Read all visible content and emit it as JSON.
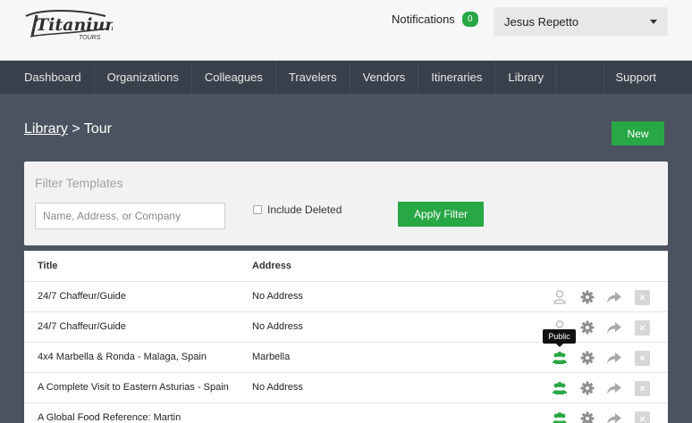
{
  "header": {
    "logo_text": "Titanium",
    "logo_sub": "TOURS",
    "notifications_label": "Notifications",
    "notifications_count": "0",
    "user_name": "Jesus Repetto"
  },
  "nav": {
    "items": [
      "Dashboard",
      "Organizations",
      "Colleagues",
      "Travelers",
      "Vendors",
      "Itineraries",
      "Library"
    ],
    "support": "Support"
  },
  "breadcrumb": {
    "parent": "Library",
    "separator": ">",
    "current": "Tour"
  },
  "actions": {
    "new_label": "New"
  },
  "filter": {
    "title": "Filter Templates",
    "search_placeholder": "Name, Address, or Company",
    "include_deleted_label": "Include Deleted",
    "apply_label": "Apply Filter"
  },
  "table": {
    "columns": [
      "Title",
      "Address"
    ],
    "rows": [
      {
        "title": "24/7 Chaffeur/Guide",
        "address": "No Address",
        "visibility": "private"
      },
      {
        "title": "24/7 Chaffeur/Guide",
        "address": "No Address",
        "visibility": "private"
      },
      {
        "title": "4x4 Marbella & Ronda - Malaga, Spain",
        "address": "Marbella",
        "visibility": "public"
      },
      {
        "title": "A Complete Visit to Eastern Asturias - Spain",
        "address": "No Address",
        "visibility": "public"
      },
      {
        "title": "A Global Food Reference: Martin",
        "address": "",
        "visibility": "public"
      }
    ]
  },
  "tooltip": {
    "text": "Public"
  },
  "colors": {
    "accent": "#28a745",
    "nav_bg": "#3a404b",
    "page_bg": "#4c5360",
    "private_icon": "#b3b3b3",
    "gear_icon": "#8e8e8e"
  }
}
